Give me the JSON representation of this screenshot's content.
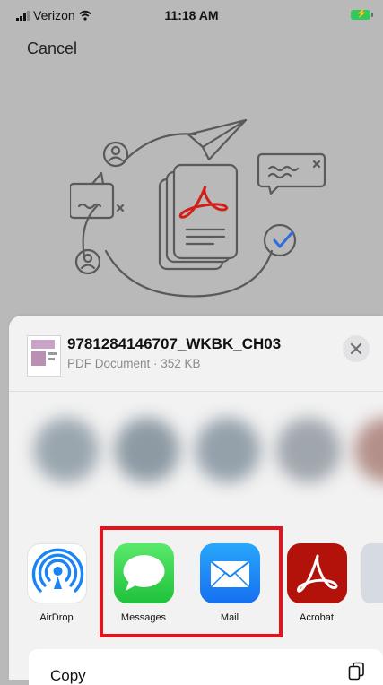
{
  "status_bar": {
    "carrier": "Verizon",
    "time": "11:18 AM"
  },
  "nav": {
    "cancel_label": "Cancel"
  },
  "file": {
    "name": "9781284146707_WKBK_CH03",
    "meta": "PDF Document · 352 KB"
  },
  "apps": [
    {
      "label": "AirDrop",
      "icon": "airdrop-icon"
    },
    {
      "label": "Messages",
      "icon": "messages-icon"
    },
    {
      "label": "Mail",
      "icon": "mail-icon"
    },
    {
      "label": "Acrobat",
      "icon": "acrobat-icon"
    }
  ],
  "actions": {
    "copy_label": "Copy"
  },
  "colors": {
    "highlight": "#e5121d",
    "messages_green": "#34c759",
    "mail_blue": "#1a84f5",
    "acrobat_red": "#b3120b"
  }
}
